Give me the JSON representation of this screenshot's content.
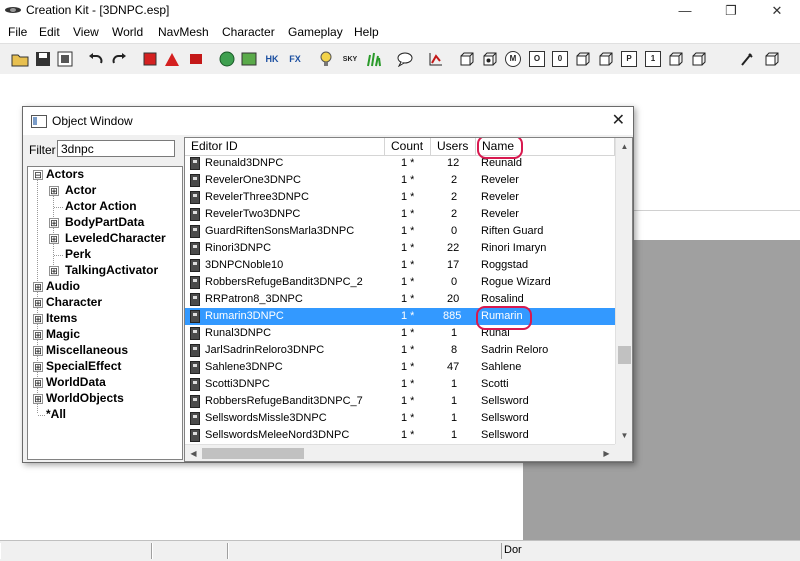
{
  "app": {
    "title": "Creation Kit - [3DNPC.esp]"
  },
  "window_controls": {
    "minimize": "—",
    "restore": "❐",
    "close": "✕"
  },
  "menu": [
    "File",
    "Edit",
    "View",
    "World",
    "NavMesh",
    "Character",
    "Gameplay",
    "Help"
  ],
  "toolbar": {
    "buttons": [
      "open",
      "save",
      "save-all",
      "undo",
      "redo",
      "render-a",
      "render-b",
      "render-c",
      "globe",
      "map",
      "hk",
      "fx",
      "bulb",
      "sky",
      "grass",
      "speech",
      "graph",
      "cube-a",
      "cube-b",
      "m",
      "o",
      "box-0",
      "cube-c",
      "cube-d",
      "p",
      "box-1",
      "cube-e",
      "cube-f",
      "tool",
      "cube-g"
    ],
    "labels": {
      "hk": "HK",
      "fx": "FX",
      "sky": "SKY",
      "m": "M",
      "o": "O",
      "box0": "0",
      "p": "P",
      "box1": "1"
    }
  },
  "object_window": {
    "title": "Object Window",
    "close": "✕",
    "filter_label": "Filter",
    "filter_value": "3dnpc",
    "tree": [
      {
        "label": "Actors",
        "expander": "⊟"
      },
      {
        "label": "Actor",
        "expander": "⊞"
      },
      {
        "label": "Actor Action",
        "expander": ""
      },
      {
        "label": "BodyPartData",
        "expander": "⊞"
      },
      {
        "label": "LeveledCharacter",
        "expander": "⊞"
      },
      {
        "label": "Perk",
        "expander": ""
      },
      {
        "label": "TalkingActivator",
        "expander": "⊞"
      },
      {
        "label": "Audio",
        "expander": "⊞"
      },
      {
        "label": "Character",
        "expander": "⊞"
      },
      {
        "label": "Items",
        "expander": "⊞"
      },
      {
        "label": "Magic",
        "expander": "⊞"
      },
      {
        "label": "Miscellaneous",
        "expander": "⊞"
      },
      {
        "label": "SpecialEffect",
        "expander": "⊞"
      },
      {
        "label": "WorldData",
        "expander": "⊞"
      },
      {
        "label": "WorldObjects",
        "expander": "⊞"
      },
      {
        "label": "*All",
        "expander": ""
      }
    ],
    "columns": [
      "Editor ID",
      "Count",
      "Users",
      "Name"
    ],
    "rows": [
      {
        "id": "Reunald3DNPC",
        "count": "1 *",
        "users": "12",
        "name": "Reunald"
      },
      {
        "id": "RevelerOne3DNPC",
        "count": "1 *",
        "users": "2",
        "name": "Reveler"
      },
      {
        "id": "RevelerThree3DNPC",
        "count": "1 *",
        "users": "2",
        "name": "Reveler"
      },
      {
        "id": "RevelerTwo3DNPC",
        "count": "1 *",
        "users": "2",
        "name": "Reveler"
      },
      {
        "id": "GuardRiftenSonsMarla3DNPC",
        "count": "1 *",
        "users": "0",
        "name": "Riften Guard"
      },
      {
        "id": "Rinori3DNPC",
        "count": "1 *",
        "users": "22",
        "name": "Rinori Imaryn"
      },
      {
        "id": "3DNPCNoble10",
        "count": "1 *",
        "users": "17",
        "name": "Roggstad"
      },
      {
        "id": "RobbersRefugeBandit3DNPC_2",
        "count": "1 *",
        "users": "0",
        "name": "Rogue Wizard"
      },
      {
        "id": "RRPatron8_3DNPC",
        "count": "1 *",
        "users": "20",
        "name": "Rosalind"
      },
      {
        "id": "Rumarin3DNPC",
        "count": "1 *",
        "users": "885",
        "name": "Rumarin",
        "selected": true
      },
      {
        "id": "Runal3DNPC",
        "count": "1 *",
        "users": "1",
        "name": "Runal"
      },
      {
        "id": "JarlSadrinReloro3DNPC",
        "count": "1 *",
        "users": "8",
        "name": "Sadrin Reloro"
      },
      {
        "id": "Sahlene3DNPC",
        "count": "1 *",
        "users": "47",
        "name": "Sahlene"
      },
      {
        "id": "Scotti3DNPC",
        "count": "1 *",
        "users": "1",
        "name": "Scotti"
      },
      {
        "id": "RobbersRefugeBandit3DNPC_7",
        "count": "1 *",
        "users": "1",
        "name": "Sellsword"
      },
      {
        "id": "SellswordsMissle3DNPC",
        "count": "1 *",
        "users": "1",
        "name": "Sellsword"
      },
      {
        "id": "SellswordsMeleeNord3DNPC",
        "count": "1 *",
        "users": "1",
        "name": "Sellsword"
      }
    ]
  },
  "status_bar": {
    "text": "Dor"
  },
  "colors": {
    "selection": "#3399ff",
    "annotation": "#d8194f",
    "workspace_gray": "#a0a0a0"
  }
}
